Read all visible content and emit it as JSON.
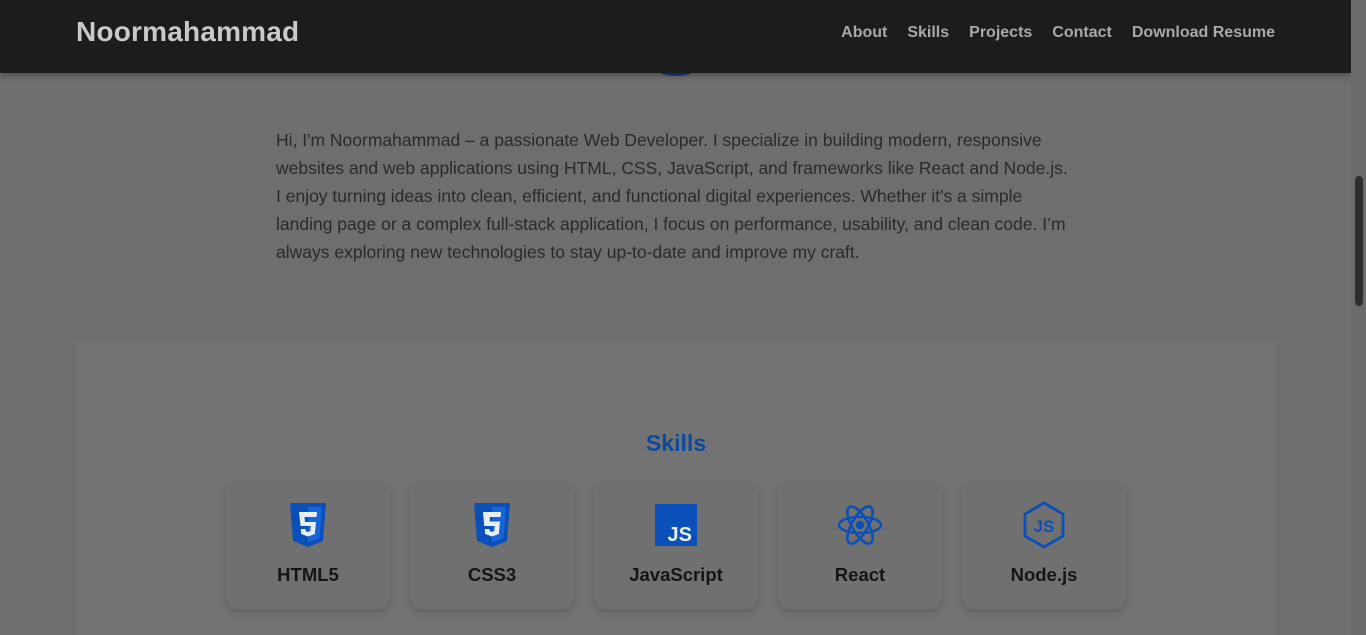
{
  "header": {
    "brand": "Noormahammad",
    "nav": [
      "About",
      "Skills",
      "Projects",
      "Contact",
      "Download Resume"
    ]
  },
  "about": {
    "text": "Hi, I'm Noormahammad – a passionate Web Developer. I specialize in building modern, responsive websites and web applications using HTML, CSS, JavaScript, and frameworks like React and Node.js. I enjoy turning ideas into clean, efficient, and functional digital experiences. Whether it's a simple landing page or a complex full-stack application, I focus on performance, usability, and clean code. I’m always exploring new technologies to stay up-to-date and improve my craft."
  },
  "skills": {
    "title": "Skills",
    "items": [
      {
        "name": "HTML5",
        "icon": "html5-icon"
      },
      {
        "name": "CSS3",
        "icon": "css3-icon"
      },
      {
        "name": "JavaScript",
        "icon": "javascript-icon"
      },
      {
        "name": "React",
        "icon": "react-icon"
      },
      {
        "name": "Node.js",
        "icon": "nodejs-icon"
      }
    ]
  },
  "colors": {
    "accent": "#0b4a9e",
    "navbar": "#1c1c1c",
    "icon_blue": "#0a50b8"
  }
}
